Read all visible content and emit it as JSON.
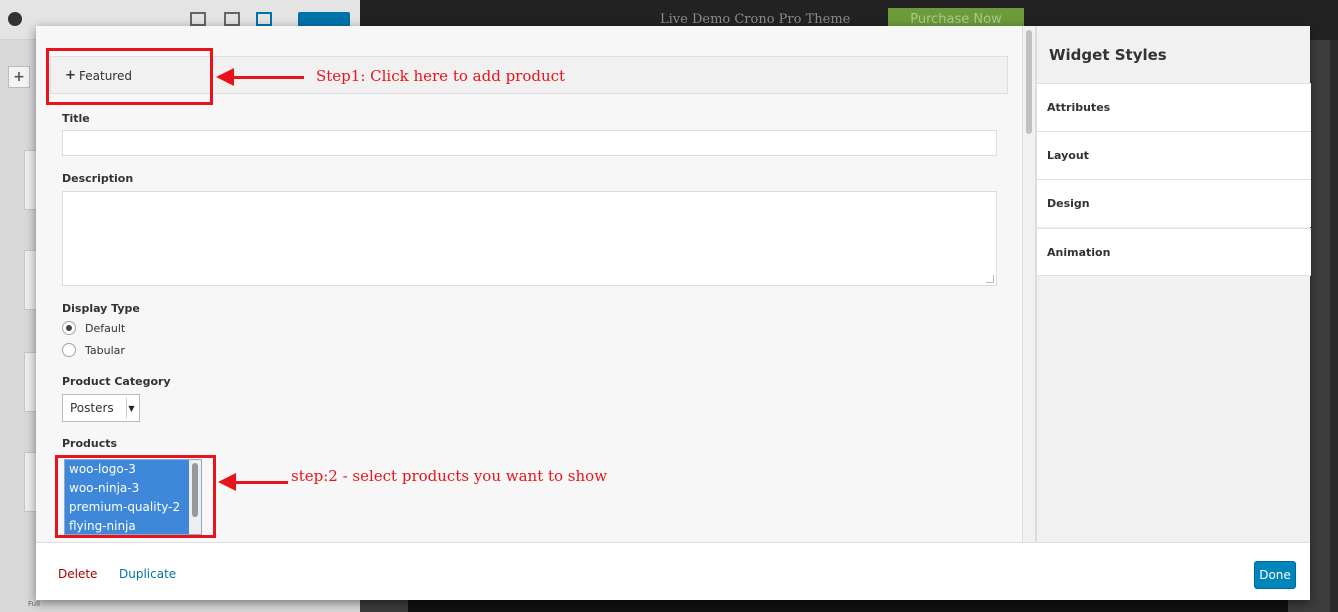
{
  "background": {
    "theme_text": "Live Demo Crono Pro Theme",
    "purchase_button": "Purchase Now",
    "layout_label": "Full"
  },
  "form": {
    "section_plus": "+",
    "section_title": "Featured",
    "title_label": "Title",
    "title_value": "",
    "description_label": "Description",
    "description_value": "",
    "display_type_label": "Display Type",
    "display_types": [
      {
        "label": "Default",
        "checked": true
      },
      {
        "label": "Tabular",
        "checked": false
      }
    ],
    "product_category_label": "Product Category",
    "product_category_value": "Posters",
    "products_label": "Products",
    "products": [
      "woo-logo-3",
      "woo-ninja-3",
      "premium-quality-2",
      "flying-ninja"
    ]
  },
  "side_panel": {
    "title": "Widget Styles",
    "items": [
      "Attributes",
      "Layout",
      "Design",
      "Animation"
    ]
  },
  "footer": {
    "delete_label": "Delete",
    "duplicate_label": "Duplicate",
    "done_label": "Done"
  },
  "annotations": {
    "step1": "Step1: Click here to add product",
    "step2": "step:2 - select products you want to show",
    "color": "#e8141b"
  }
}
